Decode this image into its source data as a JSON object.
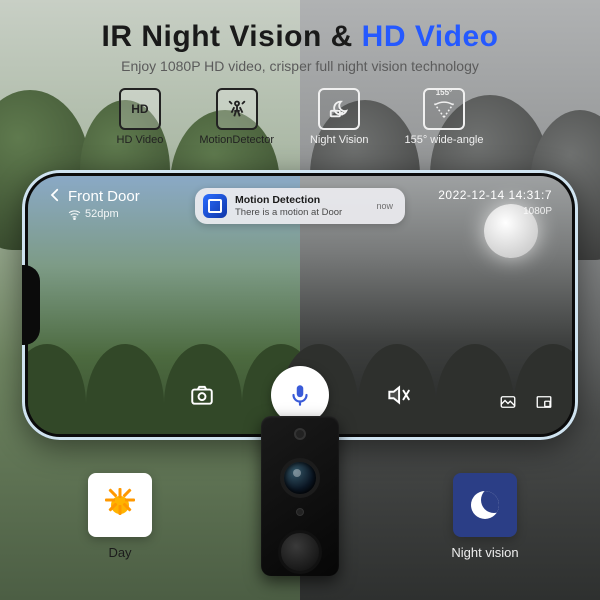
{
  "header": {
    "title_a": "IR Night Vision & ",
    "title_b": "HD Video",
    "subtitle": "Enjoy 1080P HD video, crisper full night vision technology"
  },
  "features": [
    {
      "icon": "HD",
      "label": "HD Video"
    },
    {
      "icon": "motion",
      "label": "MotionDetector"
    },
    {
      "icon": "night",
      "label": "Night Vision"
    },
    {
      "icon": "155°",
      "label": "155° wide-angle"
    }
  ],
  "phone": {
    "room": "Front Door",
    "wifi": "52dpm",
    "datetime": "2022-12-14  14:31:7",
    "quality": "1080P",
    "toast": {
      "title": "Motion Detection",
      "body": "There is a motion at Door",
      "ago": "now"
    }
  },
  "legend": {
    "day": "Day",
    "night": "Night vision"
  }
}
